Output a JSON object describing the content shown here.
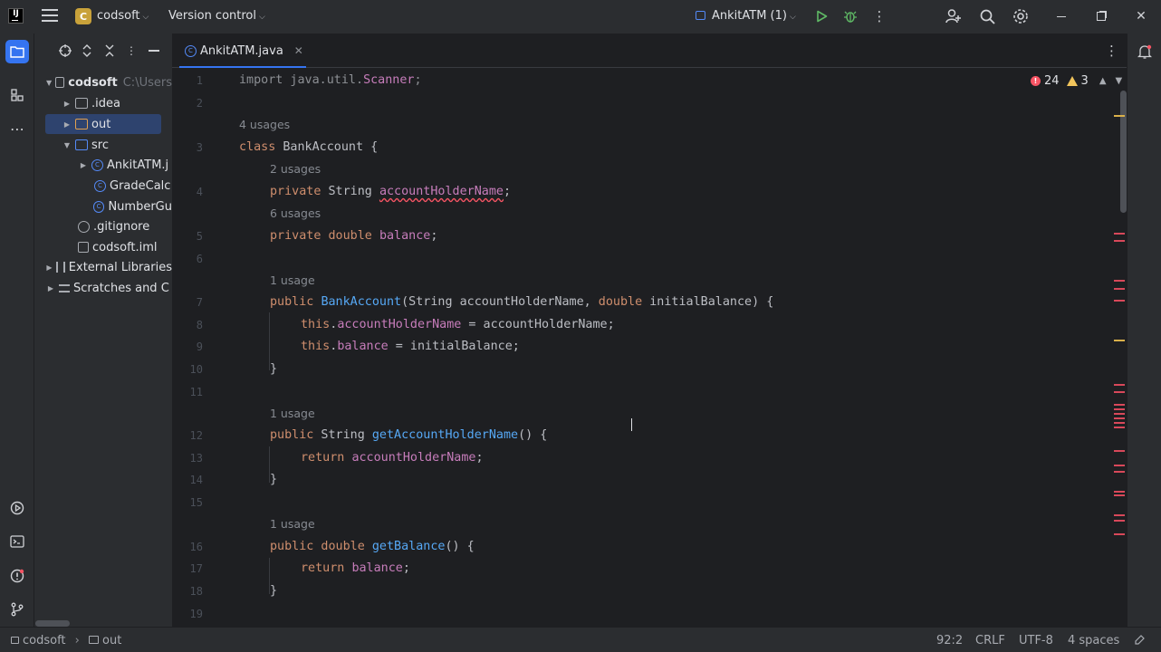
{
  "titlebar": {
    "logo_letter": "IJ",
    "project_badge": "C",
    "project_name": "codsoft",
    "vcs_label": "Version control",
    "run_config": "AnkitATM (1)"
  },
  "tab": {
    "label": "AnkitATM.java"
  },
  "project_tree": {
    "root": "codsoft",
    "root_path": "C:\\Users",
    "items": [
      {
        "label": ".idea"
      },
      {
        "label": "out"
      },
      {
        "label": "src"
      },
      {
        "label": "AnkitATM.j"
      },
      {
        "label": "GradeCalc"
      },
      {
        "label": "NumberGu"
      },
      {
        "label": ".gitignore"
      },
      {
        "label": "codsoft.iml"
      },
      {
        "label": "External Libraries"
      },
      {
        "label": "Scratches and C"
      }
    ]
  },
  "inspections": {
    "errors": "24",
    "warnings": "3"
  },
  "gutter": [
    "1",
    "2",
    "3",
    "4",
    "5",
    "6",
    "7",
    "8",
    "9",
    "10",
    "11",
    "12",
    "13",
    "14",
    "15",
    "16",
    "17",
    "18",
    "19"
  ],
  "hints": {
    "h3": "4 usages",
    "h4": "2 usages",
    "h5": "6 usages",
    "h7": "1 usage",
    "h12": "1 usage",
    "h16": "1 usage"
  },
  "code": {
    "l1_a": "import java.util.",
    "l1_b": "Scanner",
    "l1_c": ";",
    "l3_kw": "class",
    "l3_rest": " BankAccount {",
    "l4_kw": "private",
    "l4_mid": " String ",
    "l4_fld": "accountHolderName",
    "l4_end": ";",
    "l5_kw": "private double",
    "l5_mid": " ",
    "l5_fld": "balance",
    "l5_end": ";",
    "l7_kw": "public",
    "l7_fn": "BankAccount",
    "l7_a": "(String accountHolderName, ",
    "l7_kw2": "double",
    "l7_b": " initialBalance) {",
    "l8_kw": "this",
    "l8_dot": ".",
    "l8_fld": "accountHolderName",
    "l8_rest": " = accountHolderName;",
    "l9_kw": "this",
    "l9_dot": ".",
    "l9_fld": "balance",
    "l9_rest": " = initialBalance;",
    "l10": "}",
    "l12_kw": "public",
    "l12_mid": " String ",
    "l12_fn": "getAccountHolderName",
    "l12_rest": "() {",
    "l13_kw": "return",
    "l13_sp": " ",
    "l13_fld": "accountHolderName",
    "l13_end": ";",
    "l14": "}",
    "l16_kw": "public double",
    "l16_sp": " ",
    "l16_fn": "getBalance",
    "l16_rest": "() {",
    "l17_kw": "return",
    "l17_sp": " ",
    "l17_fld": "balance",
    "l17_end": ";",
    "l18": "}"
  },
  "statusbar": {
    "crumb_project": "codsoft",
    "crumb_folder": "out",
    "position": "92:2",
    "line_sep": "CRLF",
    "encoding": "UTF-8",
    "indent": "4 spaces"
  },
  "colors": {
    "accent": "#3574f0",
    "error": "#f75464",
    "warning": "#f2c55c",
    "keyword": "#cf8e6d",
    "field": "#c77dbb",
    "function": "#56a8f5"
  },
  "icons": [
    "menu-icon",
    "run-icon",
    "debug-icon",
    "more-icon",
    "add-user-icon",
    "search-icon",
    "settings-icon",
    "minimize-icon",
    "restore-icon",
    "close-icon",
    "folder-icon",
    "structure-icon",
    "ellipsis-icon",
    "services-icon",
    "terminal-icon",
    "problems-icon",
    "git-icon",
    "notifications-icon"
  ]
}
